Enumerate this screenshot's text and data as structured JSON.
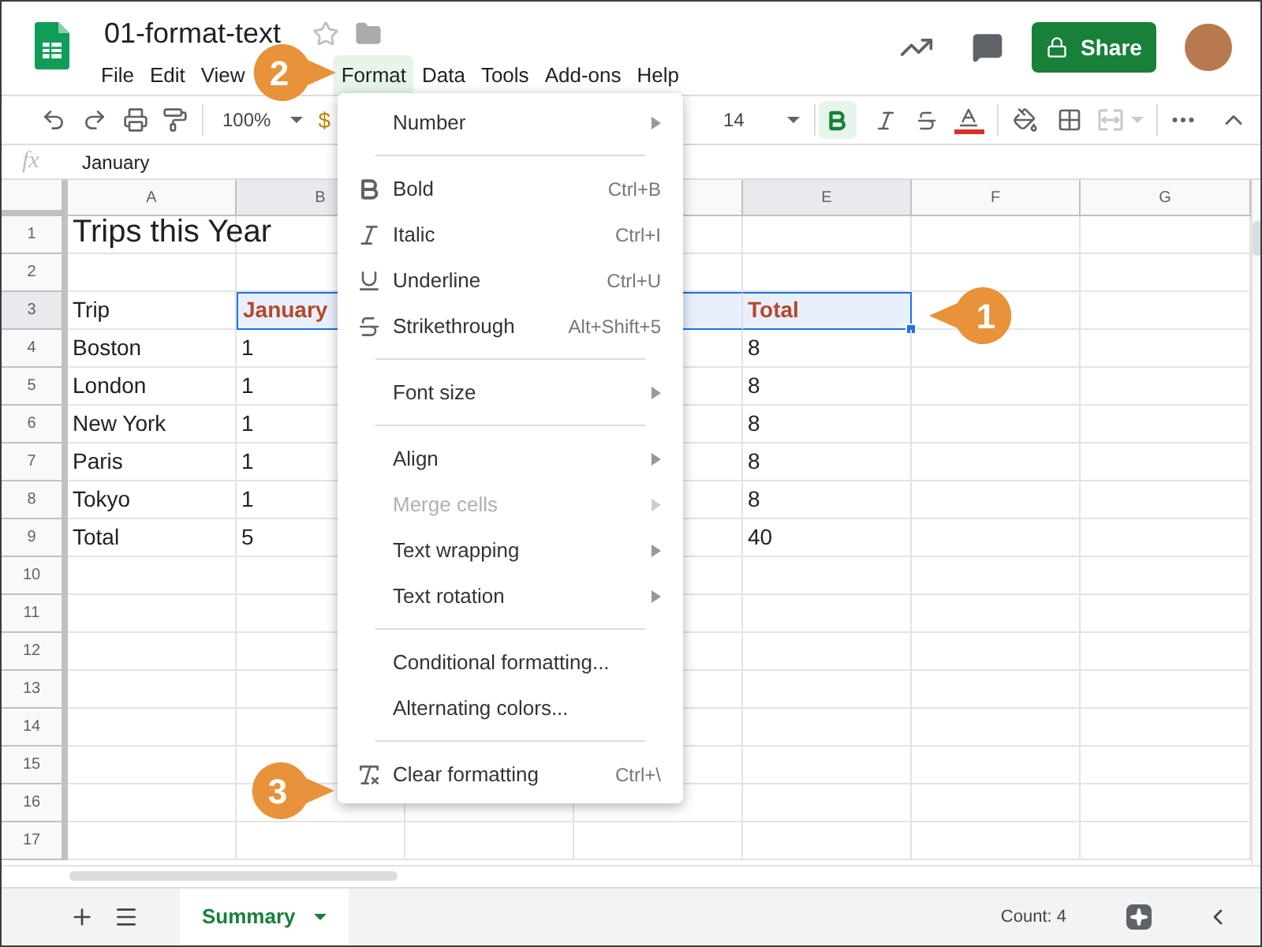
{
  "document": {
    "title": "01-format-text"
  },
  "menu_bar": [
    {
      "label": "File",
      "selected": false
    },
    {
      "label": "Edit",
      "selected": false
    },
    {
      "label": "View",
      "selected": false
    },
    {
      "label": "Format",
      "selected": true
    },
    {
      "label": "Data",
      "selected": false
    },
    {
      "label": "Tools",
      "selected": false
    },
    {
      "label": "Add-ons",
      "selected": false
    },
    {
      "label": "Help",
      "selected": false
    }
  ],
  "share_button": "Share",
  "toolbar": {
    "zoom": "100%",
    "currency": "$",
    "font_size": "14",
    "bold": true
  },
  "formula_bar": {
    "label": "fx",
    "value": "January"
  },
  "columns": [
    {
      "label": "A",
      "selected": false
    },
    {
      "label": "B",
      "selected": true
    },
    {
      "label": "E",
      "selected": true
    },
    {
      "label": "F",
      "selected": false
    },
    {
      "label": "G",
      "selected": false
    }
  ],
  "rows": [
    {
      "number": "1",
      "kind": "title",
      "selected": false,
      "A": "Trips this Year"
    },
    {
      "number": "2",
      "kind": "data",
      "selected": false
    },
    {
      "number": "3",
      "kind": "header",
      "selected": true,
      "A": "Trip",
      "B": "January",
      "E": "Total"
    },
    {
      "number": "4",
      "kind": "data",
      "selected": false,
      "A": "Boston",
      "B": "1",
      "E": "8"
    },
    {
      "number": "5",
      "kind": "data",
      "selected": false,
      "A": "London",
      "B": "1",
      "E": "8"
    },
    {
      "number": "6",
      "kind": "data",
      "selected": false,
      "A": "New York",
      "B": "1",
      "E": "8"
    },
    {
      "number": "7",
      "kind": "data",
      "selected": false,
      "A": "Paris",
      "B": "1",
      "E": "8"
    },
    {
      "number": "8",
      "kind": "data",
      "selected": false,
      "A": "Tokyo",
      "B": "1",
      "E": "8"
    },
    {
      "number": "9",
      "kind": "data",
      "selected": false,
      "A": "Total",
      "B": "5",
      "E": "40"
    },
    {
      "number": "10",
      "kind": "data",
      "selected": false
    },
    {
      "number": "11",
      "kind": "data",
      "selected": false
    },
    {
      "number": "12",
      "kind": "data",
      "selected": false
    },
    {
      "number": "13",
      "kind": "data",
      "selected": false
    },
    {
      "number": "14",
      "kind": "data",
      "selected": false
    },
    {
      "number": "15",
      "kind": "data",
      "selected": false
    },
    {
      "number": "16",
      "kind": "data",
      "selected": false
    },
    {
      "number": "17",
      "kind": "data",
      "selected": false
    }
  ],
  "format_menu": [
    {
      "kind": "plain",
      "label": "Number",
      "submenu": true,
      "disabled": false
    },
    {
      "kind": "divider"
    },
    {
      "kind": "bold",
      "label": "Bold",
      "shortcut": "Ctrl+B",
      "submenu": false,
      "disabled": false
    },
    {
      "kind": "italic",
      "label": "Italic",
      "shortcut": "Ctrl+I",
      "submenu": false,
      "disabled": false
    },
    {
      "kind": "underline",
      "label": "Underline",
      "shortcut": "Ctrl+U",
      "submenu": false,
      "disabled": false
    },
    {
      "kind": "strikethrough",
      "label": "Strikethrough",
      "shortcut": "Alt+Shift+5",
      "submenu": false,
      "disabled": false
    },
    {
      "kind": "divider"
    },
    {
      "kind": "plain",
      "label": "Font size",
      "submenu": true,
      "disabled": false
    },
    {
      "kind": "divider"
    },
    {
      "kind": "plain",
      "label": "Align",
      "submenu": true,
      "disabled": false
    },
    {
      "kind": "plain",
      "label": "Merge cells",
      "submenu": true,
      "disabled": true
    },
    {
      "kind": "plain",
      "label": "Text wrapping",
      "submenu": true,
      "disabled": false
    },
    {
      "kind": "plain",
      "label": "Text rotation",
      "submenu": true,
      "disabled": false
    },
    {
      "kind": "divider"
    },
    {
      "kind": "plain",
      "label": "Conditional formatting...",
      "submenu": false,
      "disabled": false
    },
    {
      "kind": "plain",
      "label": "Alternating colors...",
      "submenu": false,
      "disabled": false
    },
    {
      "kind": "divider"
    },
    {
      "kind": "clear",
      "label": "Clear formatting",
      "shortcut": "Ctrl+\\",
      "submenu": false,
      "disabled": false
    }
  ],
  "sheet_tabs": [
    {
      "label": "Summary",
      "selected": true
    }
  ],
  "status": "Count: 4",
  "callouts": [
    {
      "number": "1"
    },
    {
      "number": "2"
    },
    {
      "number": "3"
    }
  ]
}
